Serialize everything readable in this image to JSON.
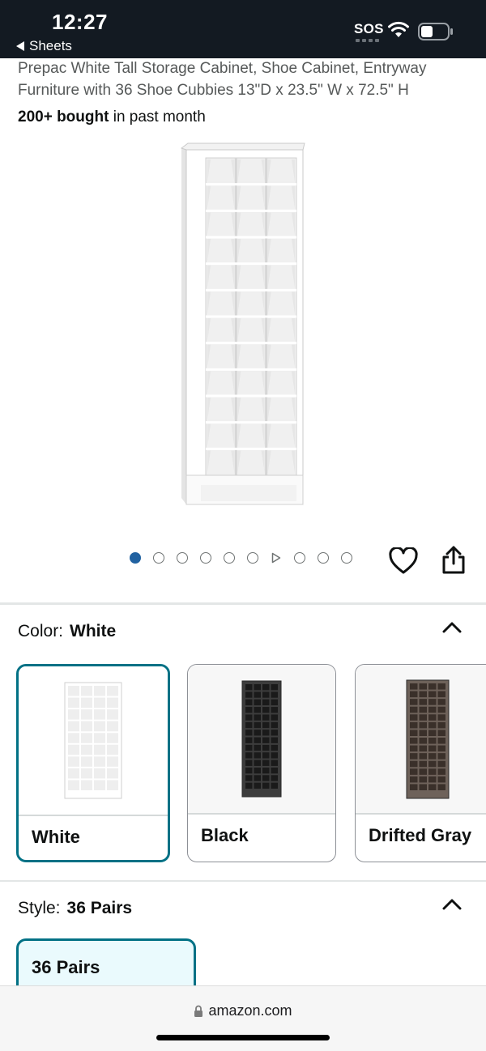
{
  "status_bar": {
    "time": "12:27",
    "back_label": "Sheets",
    "sos": "SOS"
  },
  "product": {
    "title": "Prepac White Tall Storage Cabinet, Shoe Cabinet, Entryway Furniture with 36 Shoe Cubbies 13\"D x 23.5\" W x 72.5\" H",
    "bought_bold": "200+ bought",
    "bought_rest": " in past month",
    "image_count": 10,
    "active_image": 1
  },
  "color_section": {
    "label": "Color:",
    "selected": "White",
    "options": [
      {
        "label": "White",
        "color": "#ffffff"
      },
      {
        "label": "Black",
        "color": "#3d3d3d"
      },
      {
        "label": "Drifted Gray",
        "color": "#6e625a"
      }
    ]
  },
  "style_section": {
    "label": "Style:",
    "selected": "36 Pairs",
    "options": [
      {
        "label": "36 Pairs"
      }
    ]
  },
  "browser": {
    "url": "amazon.com"
  },
  "colors": {
    "accent": "#007185",
    "dot_active": "#2162a1"
  }
}
